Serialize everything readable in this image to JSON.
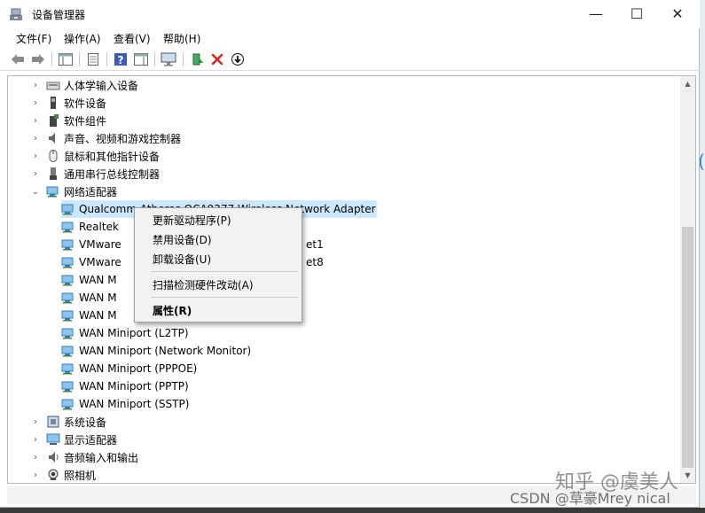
{
  "window": {
    "title": "设备管理器"
  },
  "controls": {
    "minimize": "—",
    "maximize": "☐",
    "close": "✕"
  },
  "menu": [
    "文件(F)",
    "操作(A)",
    "查看(V)",
    "帮助(H)"
  ],
  "toolbar_icons": [
    "back-arrow-icon",
    "forward-arrow-icon",
    "show-hide-console-tree-icon",
    "properties-icon",
    "help-icon",
    "action-pane-icon",
    "monitor-icon",
    "update-driver-icon",
    "uninstall-device-icon",
    "scan-hardware-icon"
  ],
  "tree": {
    "categories_top": [
      {
        "label": "人体学输入设备",
        "icon": "hid-icon"
      },
      {
        "label": "软件设备",
        "icon": "software-device-icon"
      },
      {
        "label": "软件组件",
        "icon": "software-component-icon"
      },
      {
        "label": "声音、视频和游戏控制器",
        "icon": "speaker-icon"
      },
      {
        "label": "鼠标和其他指针设备",
        "icon": "mouse-icon"
      },
      {
        "label": "通用串行总线控制器",
        "icon": "usb-icon"
      }
    ],
    "network_category": {
      "label": "网络适配器",
      "icon": "network-adapter-icon"
    },
    "adapters": [
      {
        "label": "Qualcomm Atheros QCA9377 Wireless Network Adapter"
      },
      {
        "label": "Realtek"
      },
      {
        "label": "VMware",
        "tail": "et1"
      },
      {
        "label": "VMware",
        "tail": "et8"
      },
      {
        "label": "WAN M"
      },
      {
        "label": "WAN M"
      },
      {
        "label": "WAN M"
      },
      {
        "label": "WAN Miniport (L2TP)"
      },
      {
        "label": "WAN Miniport (Network Monitor)"
      },
      {
        "label": "WAN Miniport (PPPOE)"
      },
      {
        "label": "WAN Miniport (PPTP)"
      },
      {
        "label": "WAN Miniport (SSTP)"
      }
    ],
    "categories_bottom": [
      {
        "label": "系统设备",
        "icon": "system-device-icon"
      },
      {
        "label": "显示适配器",
        "icon": "display-adapter-icon"
      },
      {
        "label": "音频输入和输出",
        "icon": "audio-io-icon"
      },
      {
        "label": "照相机",
        "icon": "camera-icon"
      }
    ]
  },
  "context_menu": {
    "items": [
      "更新驱动程序(P)",
      "禁用设备(D)",
      "卸载设备(U)",
      "扫描检测硬件改动(A)",
      "属性(R)"
    ]
  },
  "watermark": {
    "zhihu": "知乎 @虞美人",
    "csdn": "CSDN @草豪Mrey nical"
  },
  "colors": {
    "selection": "#cce8ff",
    "adapter_icon": "#2f7fc8",
    "uninstall_red": "#d62a1e",
    "update_green": "#3a9a3a"
  }
}
